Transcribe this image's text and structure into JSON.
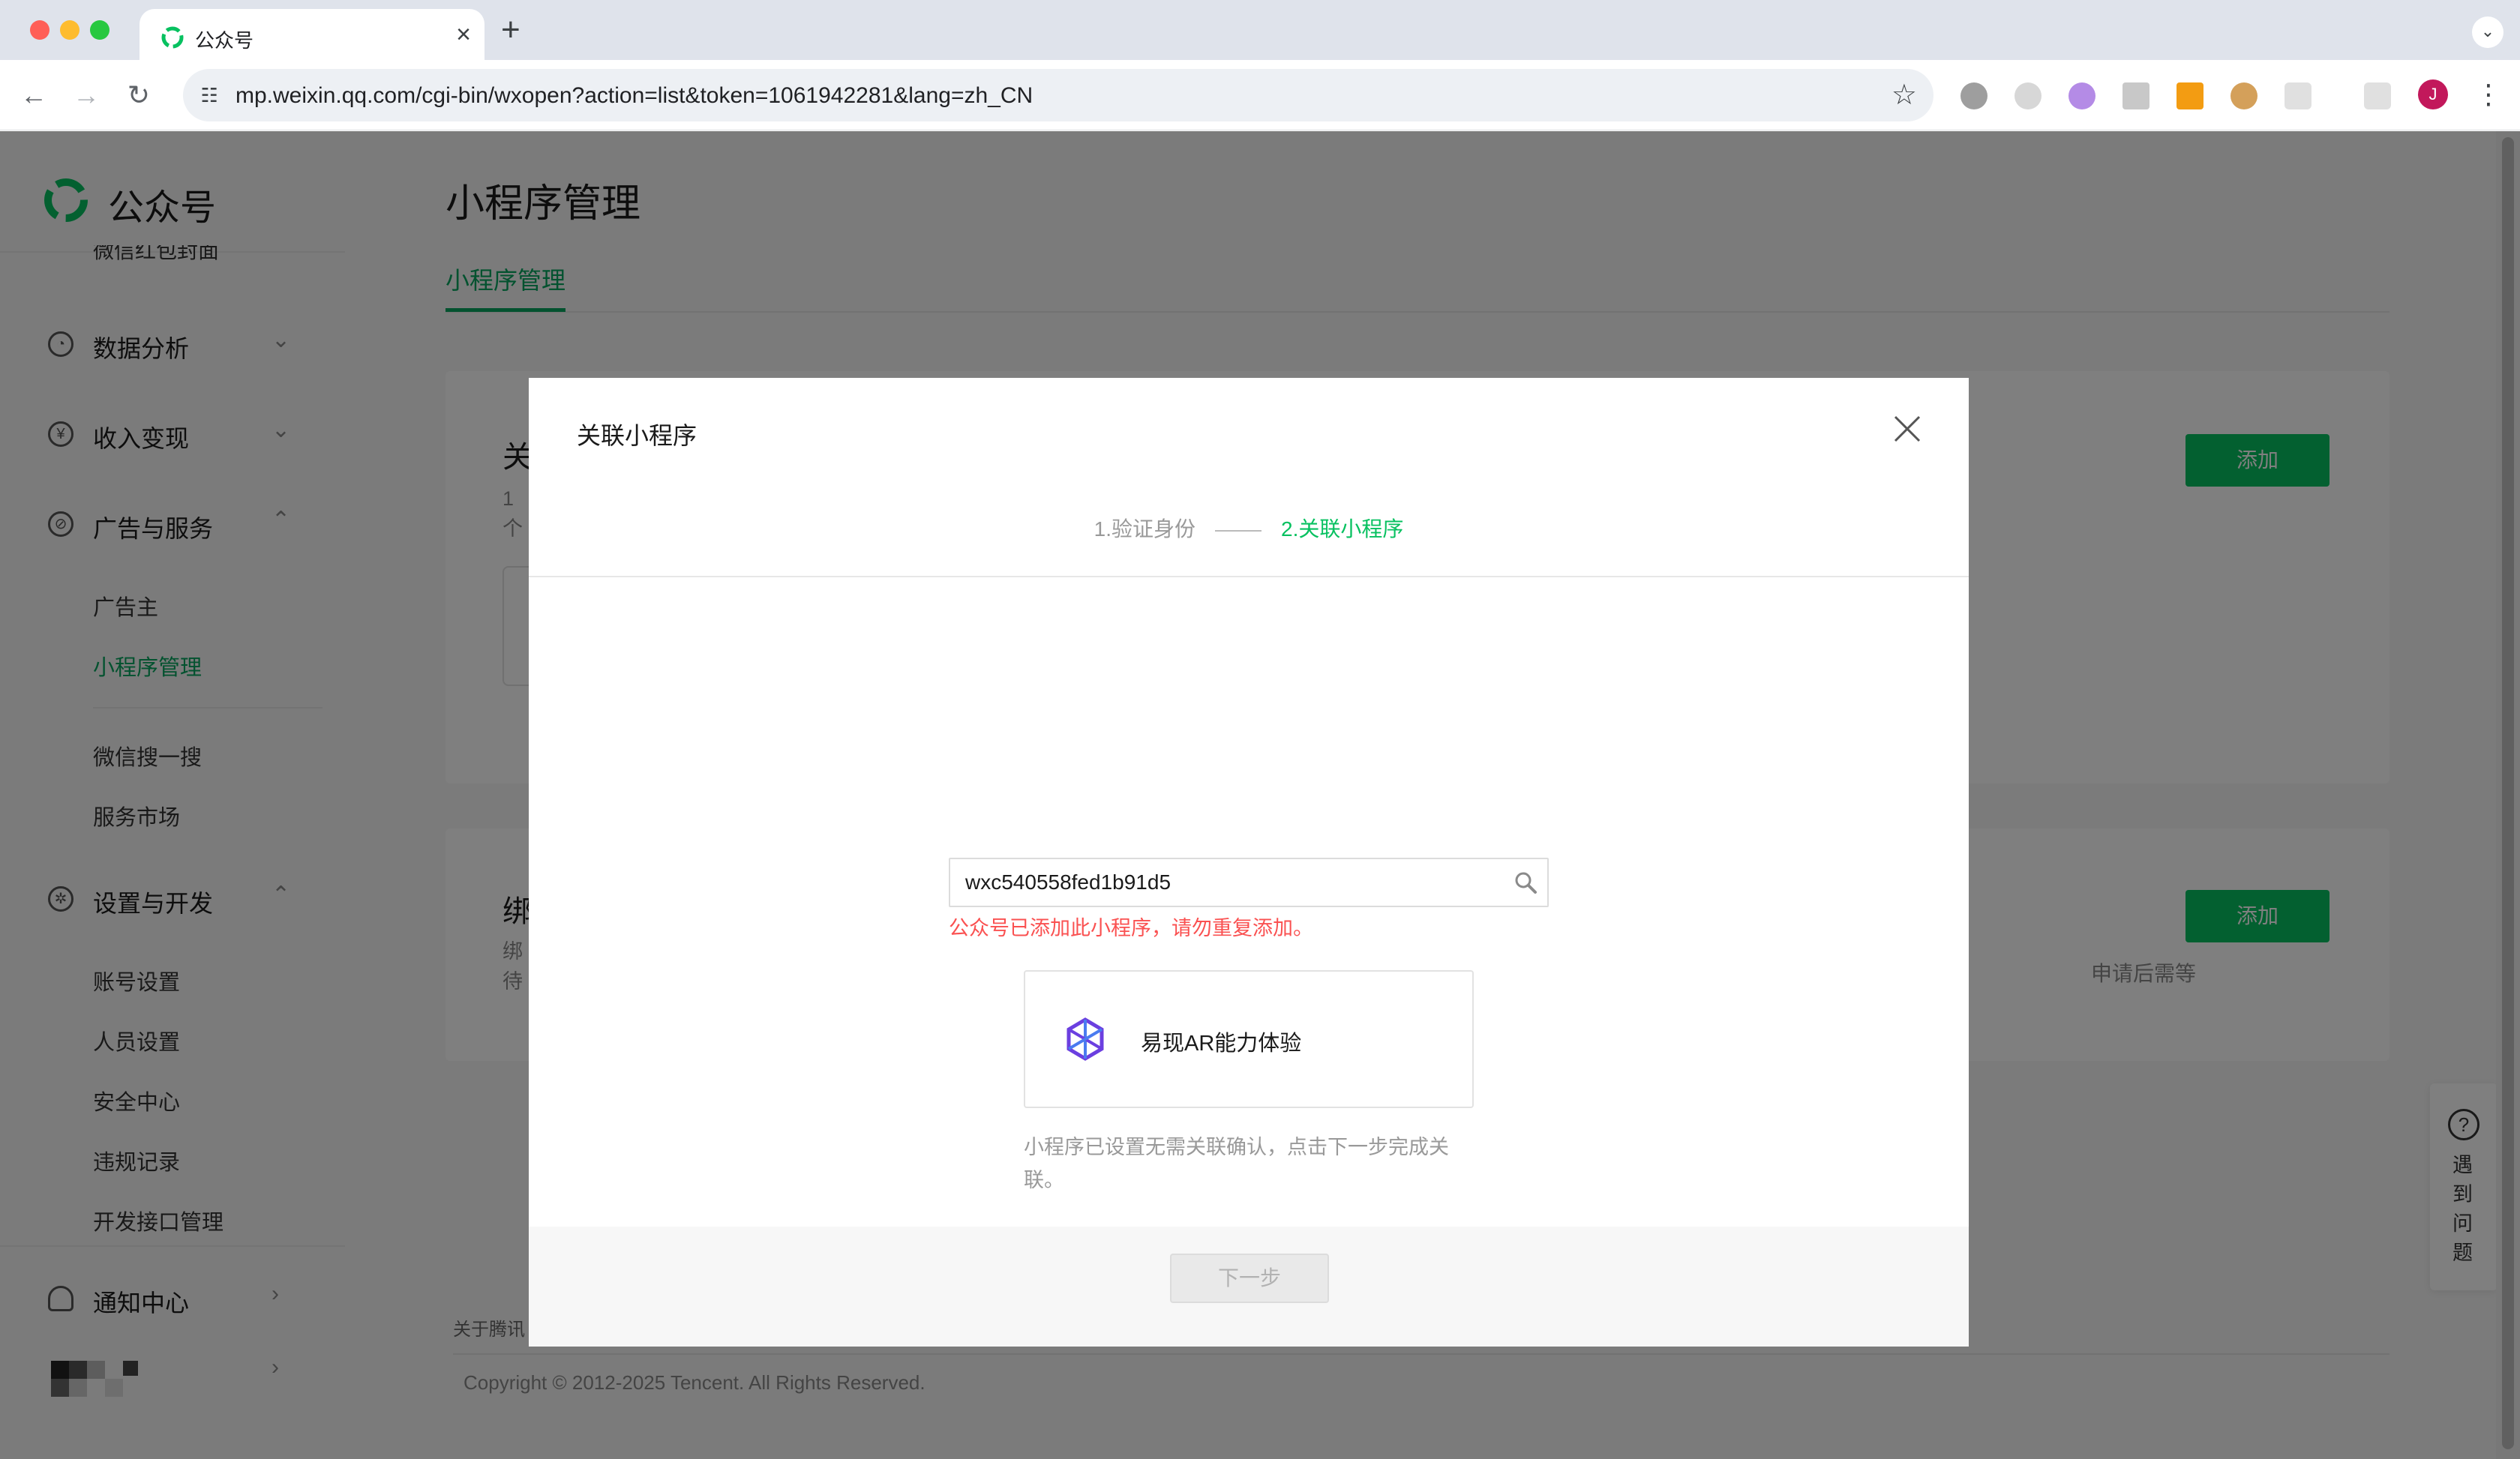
{
  "browser": {
    "tab_title": "公众号",
    "url": "mp.weixin.qq.com/cgi-bin/wxopen?action=list&token=1061942281&lang=zh_CN",
    "profile_initial": "J"
  },
  "sidebar": {
    "logo_text": "公众号",
    "cut_item": "微信红包封面",
    "groups": [
      {
        "label": "数据分析",
        "icon": "chart-pie-icon",
        "state": "collapsed"
      },
      {
        "label": "收入变现",
        "icon": "yen-icon",
        "state": "collapsed"
      },
      {
        "label": "广告与服务",
        "icon": "compass-icon",
        "state": "expanded"
      },
      {
        "label": "设置与开发",
        "icon": "gear-icon",
        "state": "expanded"
      },
      {
        "label": "通知中心",
        "icon": "bell-icon",
        "state": "link"
      }
    ],
    "ads_items": [
      "广告主",
      "小程序管理",
      "微信搜一搜",
      "服务市场"
    ],
    "settings_items": [
      "账号设置",
      "人员设置",
      "安全中心",
      "违规记录",
      "开发接口管理"
    ],
    "active_item": "小程序管理"
  },
  "main": {
    "title": "小程序管理",
    "tab": "小程序管理",
    "card1_heading": "关",
    "card1_sub": "1个",
    "card2_heading": "绑",
    "card2_sub1": "绑",
    "card2_sub2": "待",
    "card2_right": "申请后需等",
    "add_label": "添加",
    "footer_link": "关于腾讯",
    "copyright": "Copyright © 2012-2025 Tencent. All Rights Reserved."
  },
  "help": {
    "label": "遇到问题"
  },
  "dialog": {
    "title": "关联小程序",
    "step1": "1.验证身份",
    "step2": "2.关联小程序",
    "search_value": "wxc540558fed1b91d5",
    "error": "公众号已添加此小程序，请勿重复添加。",
    "app_name": "易现AR能力体验",
    "hint": "小程序已设置无需关联确认，点击下一步完成关联。",
    "next_label": "下一步"
  },
  "colors": {
    "brand_green": "#07c160",
    "active_green": "#07a55e",
    "error_red": "#fa5151",
    "overlay": "rgba(0,0,0,0.5)"
  }
}
